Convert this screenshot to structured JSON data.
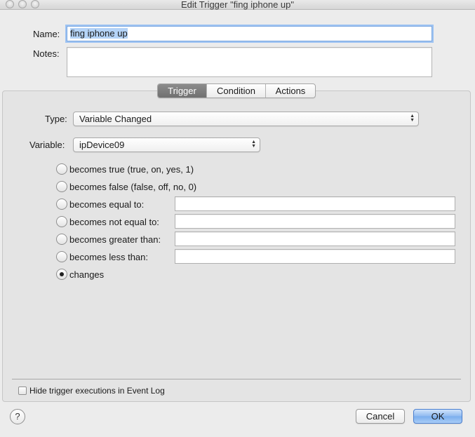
{
  "window": {
    "title": "Edit Trigger \"fing iphone up\""
  },
  "form": {
    "name_label": "Name:",
    "name_value": "fing iphone up",
    "notes_label": "Notes:",
    "notes_value": ""
  },
  "tabs": [
    {
      "label": "Trigger",
      "active": true
    },
    {
      "label": "Condition",
      "active": false
    },
    {
      "label": "Actions",
      "active": false
    }
  ],
  "trigger": {
    "type_label": "Type:",
    "type_value": "Variable Changed",
    "variable_label": "Variable:",
    "variable_value": "ipDevice09",
    "options": [
      {
        "label": "becomes true (true, on, yes, 1)",
        "selected": false,
        "has_field": false
      },
      {
        "label": "becomes false (false, off, no, 0)",
        "selected": false,
        "has_field": false
      },
      {
        "label": "becomes equal to:",
        "selected": false,
        "has_field": true,
        "value": ""
      },
      {
        "label": "becomes not equal to:",
        "selected": false,
        "has_field": true,
        "value": ""
      },
      {
        "label": "becomes greater than:",
        "selected": false,
        "has_field": true,
        "value": ""
      },
      {
        "label": "becomes less than:",
        "selected": false,
        "has_field": true,
        "value": ""
      },
      {
        "label": "changes",
        "selected": true,
        "has_field": false
      }
    ]
  },
  "footer": {
    "hide_log_label": "Hide trigger executions in Event Log",
    "hide_log_checked": false,
    "help_label": "?",
    "cancel_label": "Cancel",
    "ok_label": "OK"
  },
  "colors": {
    "accent": "#7aaeed",
    "active_tab": "#7f7f7f",
    "focus_ring": "#9ec3f2"
  }
}
